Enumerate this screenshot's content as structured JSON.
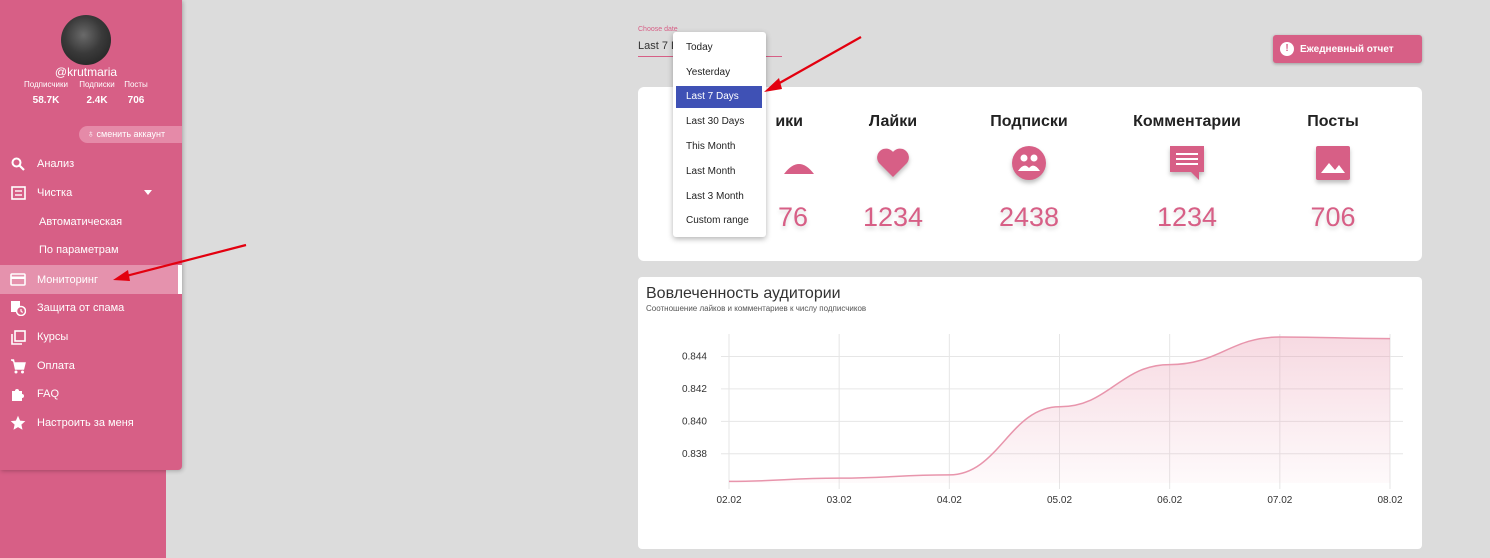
{
  "sidebar": {
    "username": "@krutmaria",
    "stats": [
      {
        "label": "Подписчики",
        "value": "58.7K"
      },
      {
        "label": "Подписки",
        "value": "2.4K"
      },
      {
        "label": "Посты",
        "value": "706"
      }
    ],
    "switch_label": "сменить аккаунт",
    "items": [
      {
        "label": "Анализ",
        "icon": "search-icon"
      },
      {
        "label": "Чистка",
        "icon": "list-icon"
      },
      {
        "label": "Автоматическая"
      },
      {
        "label": "По параметрам"
      },
      {
        "label": "Мониторинг",
        "icon": "card-icon"
      },
      {
        "label": "Защита от спама",
        "icon": "shield-clock-icon"
      },
      {
        "label": "Курсы",
        "icon": "library-icon"
      },
      {
        "label": "Оплата",
        "icon": "cart-icon"
      },
      {
        "label": "FAQ",
        "icon": "puzzle-icon"
      },
      {
        "label": "Настроить за меня",
        "icon": "star-icon"
      }
    ],
    "color": "#d75f86"
  },
  "date_picker": {
    "label": "Choose date",
    "value": "Last 7 D",
    "options": [
      "Today",
      "Yesterday",
      "Last 7 Days",
      "Last 30 Days",
      "This Month",
      "Last Month",
      "Last 3 Month",
      "Custom range"
    ],
    "selected": "Last 7 Days"
  },
  "report_button": {
    "label": "Ежедневный отчет",
    "icon": "!"
  },
  "stats_card": {
    "columns": [
      {
        "title": "ики",
        "value": "76",
        "icon": "followers-icon"
      },
      {
        "title": "Лайки",
        "value": "1234",
        "icon": "heart-icon"
      },
      {
        "title": "Подписки",
        "value": "2438",
        "icon": "people-icon"
      },
      {
        "title": "Комментарии",
        "value": "1234",
        "icon": "comment-icon"
      },
      {
        "title": "Посты",
        "value": "706",
        "icon": "image-icon"
      }
    ]
  },
  "chart_data": {
    "type": "area",
    "title": "Вовлеченность аудитории",
    "subtitle": "Соотношение лайков и комментариев к числу подписчиков",
    "categories": [
      "02.02",
      "03.02",
      "04.02",
      "05.02",
      "06.02",
      "07.02",
      "08.02"
    ],
    "values": [
      0.8363,
      0.8365,
      0.8367,
      0.8409,
      0.8435,
      0.8452,
      0.8451
    ],
    "yticks": [
      0.838,
      0.84,
      0.842,
      0.844
    ],
    "ylim": [
      0.8362,
      0.8452
    ],
    "grid": true,
    "color": "#e895ac"
  },
  "accent_colors": {
    "primary": "#d75f86",
    "selected": "#3f51b5",
    "annotation": "#e3000f"
  }
}
